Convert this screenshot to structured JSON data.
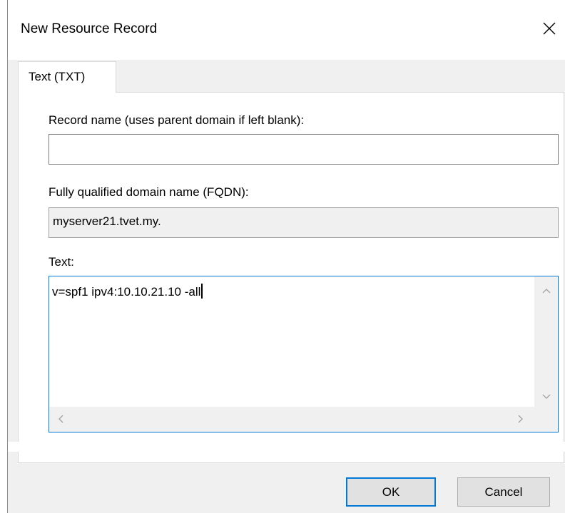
{
  "window": {
    "title": "New Resource Record"
  },
  "tabs": [
    {
      "label": "Text (TXT)",
      "active": true
    }
  ],
  "fields": {
    "record_name": {
      "label": "Record name (uses parent domain if left blank):",
      "value": ""
    },
    "fqdn": {
      "label": "Fully qualified domain name (FQDN):",
      "value": "myserver21.tvet.my."
    },
    "text": {
      "label": "Text:",
      "value": "v=spf1 ipv4:10.10.21.10 -all"
    }
  },
  "buttons": {
    "ok": "OK",
    "cancel": "Cancel"
  },
  "icons": {
    "close": "close-icon",
    "scroll_up": "chevron-up-icon",
    "scroll_down": "chevron-down-icon",
    "scroll_left": "chevron-left-icon",
    "scroll_right": "chevron-right-icon"
  },
  "colors": {
    "accent": "#0078d7",
    "dialog_bg": "#f0f0f0",
    "button_bg": "#e1e1e1"
  }
}
